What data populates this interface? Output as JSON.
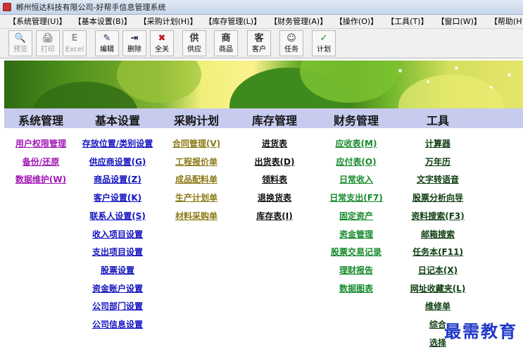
{
  "window": {
    "title": "郴州恒达科技有限公司-好帮手信息管理系统"
  },
  "menu": [
    "【系统管理(U)】",
    "【基本设置(B)】",
    "【采购计划(H)】",
    "【库存管理(L)】",
    "【财务管理(A)】",
    "【操作(O)】",
    "【工具(T)】",
    "【窗口(W)】",
    "【帮助(H)】"
  ],
  "toolbar": [
    {
      "label": "预览",
      "icon": "magnifier-icon",
      "glyph": "🔍",
      "enabled": false
    },
    {
      "label": "打印",
      "icon": "printer-icon",
      "glyph": "🖨",
      "enabled": false
    },
    {
      "label": "Excel",
      "icon": "excel-icon",
      "glyph": "E",
      "enabled": false
    },
    {
      "label": "编辑",
      "icon": "edit-icon",
      "glyph": "✎",
      "enabled": true
    },
    {
      "label": "删除",
      "icon": "delete-icon",
      "glyph": "⇥",
      "enabled": true
    },
    {
      "label": "全关",
      "icon": "close-all-icon",
      "glyph": "✖",
      "enabled": true
    },
    {
      "label": "供应",
      "icon": "supply-icon",
      "glyph": "供",
      "enabled": true
    },
    {
      "label": "商品",
      "icon": "goods-icon",
      "glyph": "商",
      "enabled": true
    },
    {
      "label": "客户",
      "icon": "customer-icon",
      "glyph": "客",
      "enabled": true
    },
    {
      "label": "任务",
      "icon": "task-icon",
      "glyph": "☺",
      "enabled": true
    },
    {
      "label": "计划",
      "icon": "plan-icon",
      "glyph": "✓",
      "enabled": true
    }
  ],
  "sections": [
    {
      "title": "系统管理",
      "color": "#a317b5",
      "links": [
        "用户权限管理",
        "备份/还原",
        "数据维护(W)"
      ]
    },
    {
      "title": "基本设置",
      "color": "#1414c0",
      "links": [
        "存放位置/类别设置",
        "供应商设置(G)",
        "商品设置(Z)",
        "客户设置(K)",
        "联系人设置(S)",
        "收入项目设置",
        "支出项目设置",
        "股票设置",
        "资金账户设置",
        "公司部门设置",
        "公司信息设置"
      ]
    },
    {
      "title": "采购计划",
      "color": "#8b7a16",
      "links": [
        "合同管理(V)",
        "工程报价单",
        "成品配料单",
        "生产计划单",
        "材料采购单"
      ]
    },
    {
      "title": "库存管理",
      "color": "#111111",
      "links": [
        "进货表",
        "出货表(D)",
        "领料表",
        "退换货表",
        "库存表(I)"
      ]
    },
    {
      "title": "财务管理",
      "color": "#158a2b",
      "links": [
        "应收表(M)",
        "应付表(O)",
        "日常收入",
        "日常支出(F7)",
        "固定资产",
        "资金管理",
        "股票交易记录",
        "理财报告",
        "数据图表"
      ]
    },
    {
      "title": "工具",
      "color": "#0d3d10",
      "links": [
        "计算器",
        "万年历",
        "文字转语音",
        "股票分析向导",
        "资料搜索(F3)",
        "邮箱搜索",
        "任务本(F11)",
        "日记本(X)",
        "网址收藏夹(L)",
        "维修单",
        "综合",
        "选择"
      ]
    }
  ],
  "watermark": "最需教育"
}
